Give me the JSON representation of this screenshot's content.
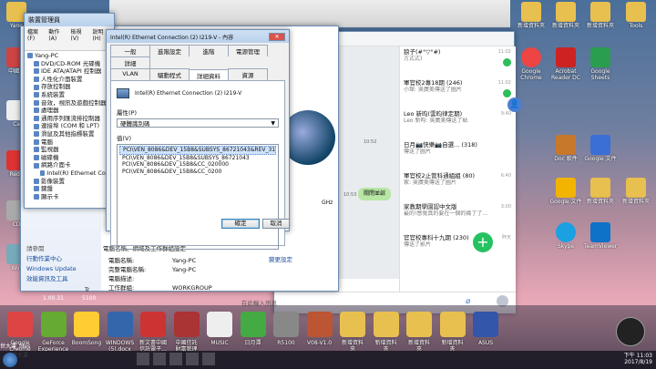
{
  "desktop_icons": {
    "yang": "Yang",
    "zhong": "中國...",
    "ca": "Ca",
    "redo": "Redo",
    "cd": "CD",
    "win": "Win",
    "new_text_left": "文件...",
    "top1": "新增資料夾",
    "top2": "新增資料夾",
    "top3": "新增資料夾",
    "top4": "Tools",
    "r1": "Google Chrome",
    "r2": "Acrobat Reader DC",
    "r3": "Google Sheets",
    "r4": "Google 文件",
    "r5": "Doc 軟件",
    "r6": "Google 文件",
    "r7": "新增資料夾",
    "r8": "Skype",
    "r9": "TeamViewer",
    "r10": "新增資料夾"
  },
  "devmgr": {
    "title": "裝置管理員",
    "menu": [
      "檔案(F)",
      "動作(A)",
      "檢視(V)",
      "說明(H)"
    ],
    "tree": [
      "Yang-PC",
      "DVD/CD-ROM 光碟機",
      "IDE ATA/ATAPI 控制器",
      "人性化介面裝置",
      "存放控制器",
      "系統裝置",
      "音效，視訊及遊戲控制器",
      "處理器",
      "通用序列匯流排控制器",
      "連接埠 (COM 和 LPT)",
      "滑鼠及其他指標裝置",
      "電腦",
      "監視器",
      "磁碟機",
      "網路介面卡",
      "Intel(R) Ethernet Co...",
      "影像裝置",
      "鍵盤",
      "顯示卡"
    ]
  },
  "props": {
    "title": "Intel(R) Ethernet Connection (2) I219-V - 內容",
    "tabs_row1": [
      "一般",
      "進階設定",
      "進階",
      "電源管理",
      "詳細"
    ],
    "tabs_row2": [
      "VLAN",
      "驅動程式",
      "詳細資料",
      "資源"
    ],
    "device_name": "Intel(R) Ethernet Connection (2) I219-V",
    "property_label": "屬性(P)",
    "property_value": "硬體識別碼",
    "value_label": "值(V)",
    "values": [
      "PCI\\VEN_8086&DEV_15B8&SUBSYS_86721043&REV_31",
      "PCI\\VEN_8086&DEV_15B8&SUBSYS_86721043",
      "PCI\\VEN_8086&DEV_15B8&CC_020000",
      "PCI\\VEN_8086&DEV_15B8&CC_0200"
    ],
    "ok": "確定",
    "cancel": "取消"
  },
  "system": {
    "left_links": [
      "請參閱",
      "行動作業中心",
      "Windows Update",
      "效能資訊及工具"
    ],
    "section_title": "電腦名稱、網域及工作群組設定",
    "rows": [
      {
        "k": "電腦名稱:",
        "v": "Yang-PC"
      },
      {
        "k": "完整電腦名稱:",
        "v": "Yang-PC"
      },
      {
        "k": "電腦描述:",
        "v": ""
      },
      {
        "k": "工作群組:",
        "v": "WORKGROUP"
      }
    ],
    "change_link": "變更設定",
    "ghz": "GHz",
    "frag1": "Tr",
    "frag2": "1.00.31",
    "frag3": "5100"
  },
  "chat": {
    "time_a": "10:52",
    "time_b": "10:53",
    "bubble": "關閉並啟",
    "input_placeholder": "在此輸入訊息",
    "items": [
      {
        "title": "狼子(#°▽°#)",
        "preview": "方式式)",
        "time": "11:02"
      },
      {
        "title": "軍官校2專18期 (246)",
        "preview": "小琛: 吳廣美傳送了圖片",
        "time": "11:02"
      },
      {
        "title": "Leo 新昀(雲昀律定期)",
        "preview": "Leo 新昀: 吳廣美傳送了貼",
        "time": "9:40"
      },
      {
        "title": "日月📷快樂📷自選... (318)",
        "preview": "傳送了圖片",
        "time": ""
      },
      {
        "title": "軍官校2止管科通組組 (80)",
        "preview": "家: 吳廣美傳送了圖片",
        "time": "6:40"
      },
      {
        "title": "家教期學園認中文版",
        "preview": "最的!感覺真的要在一個的幾了了...",
        "time": "3:00"
      },
      {
        "title": "官官校專科十九期 (230)",
        "preview": "傳送了影片",
        "time": "昨天"
      }
    ]
  },
  "taskbar": {
    "apps": [
      {
        "label": "Google Chrome\n世大運",
        "color": "#d44"
      },
      {
        "label": "GeForce\nExperience",
        "color": "#6a3"
      },
      {
        "label": "BoomSong",
        "color": "#fc3"
      },
      {
        "label": "WINDOWS\n(5).docx",
        "color": "#36a"
      },
      {
        "label": "新文書中國\n信託電子...",
        "color": "#c33"
      },
      {
        "label": "中國信託\n財富管理",
        "color": "#a33"
      },
      {
        "label": "MUSIC",
        "color": "#eee"
      },
      {
        "label": "日月潭",
        "color": "#4a4"
      },
      {
        "label": "R5100",
        "color": "#888"
      },
      {
        "label": "V08-V1.0",
        "color": "#b53"
      },
      {
        "label": "新增資料\n夾",
        "color": "#e8c050"
      },
      {
        "label": "新增資料\n夾",
        "color": "#e8c050"
      },
      {
        "label": "新增資料\n夾",
        "color": "#e8c050"
      },
      {
        "label": "新增資料\n夾",
        "color": "#e8c050"
      },
      {
        "label": "ASUS",
        "color": "#35a"
      }
    ],
    "clock_time": "下午 11:03",
    "clock_date": "2017/8/19",
    "tray_label": "世大運_files"
  }
}
